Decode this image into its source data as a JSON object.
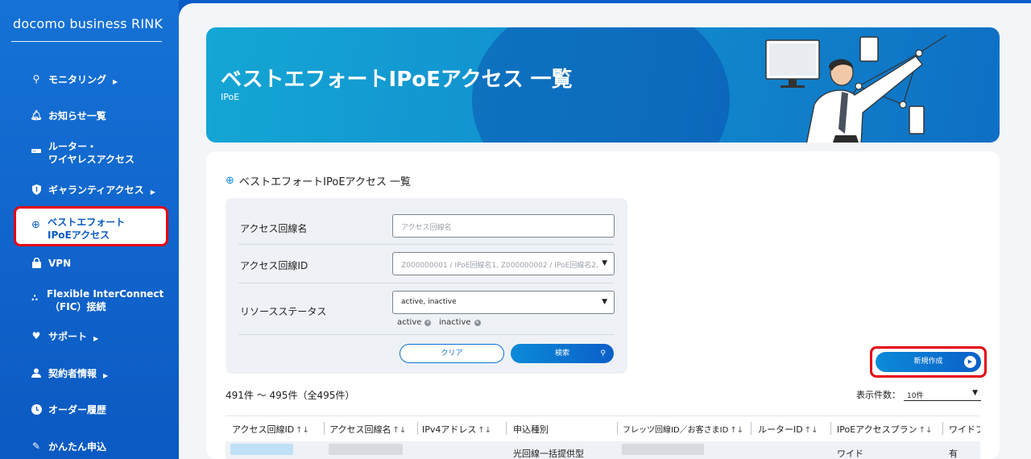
{
  "sidebar": {
    "brand": "docomo business RINK",
    "items": [
      {
        "label": "モニタリング",
        "icon": "search-icon"
      },
      {
        "label": "お知らせ一覧",
        "icon": "bell-icon"
      },
      {
        "label": "ルーター・",
        "label2": "ワイヤレスアクセス",
        "icon": "router-icon"
      },
      {
        "label": "ギャランティアクセス",
        "icon": "shield-icon"
      },
      {
        "label": "ベストエフォート",
        "label2": "IPoEアクセス",
        "icon": "globe-icon"
      },
      {
        "label": "VPN",
        "icon": "lock-icon"
      },
      {
        "label": "Flexible InterConnect",
        "label2": "（FIC）接続",
        "icon": "network-icon"
      },
      {
        "label": "サポート",
        "icon": "heart-icon"
      },
      {
        "label": "契約者情報",
        "icon": "person-icon"
      },
      {
        "label": "オーダー履歴",
        "icon": "clock-icon"
      },
      {
        "label": "かんたん申込",
        "icon": "edit-icon"
      }
    ]
  },
  "hero": {
    "title": "ベストエフォートIPoEアクセス 一覧",
    "subtitle": "IPoE"
  },
  "panel": {
    "title": "ベストエフォートIPoEアクセス 一覧"
  },
  "search": {
    "rows": [
      {
        "label": "アクセス回線名",
        "placeholder": "アクセス回線名"
      },
      {
        "label": "アクセス回線ID",
        "placeholder": "Z000000001 / IPoE回線名1, Z000000002 / IPoE回線名2,"
      },
      {
        "label": "リソースステータス",
        "value": "active, inactive"
      }
    ],
    "chips": [
      "active",
      "inactive"
    ],
    "clear_label": "クリア",
    "search_label": "検索"
  },
  "new_button": "新規作成",
  "results": {
    "count": "491件 ～ 495件（全495件）",
    "per_page_label": "表示件数：",
    "per_page_value": "10件"
  },
  "table": {
    "columns": [
      "アクセス回線ID",
      "アクセス回線名",
      "IPv4アドレス",
      "申込種別",
      "フレッツ回線ID／お客さまID",
      "ルーターID",
      "IPoEアクセスプラン",
      "ワイドプ"
    ],
    "row": {
      "type": "光回線一括提供型",
      "plan": "ワイド",
      "wide": "有"
    }
  }
}
